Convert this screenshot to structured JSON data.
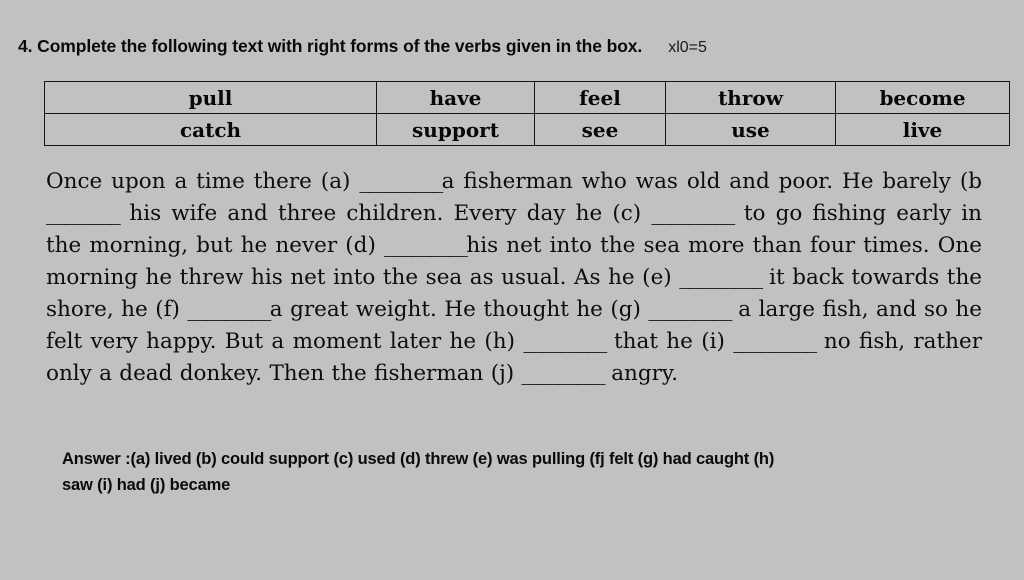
{
  "page": {
    "background_color": "#c1c1c1",
    "text_color": "#0d0d0d"
  },
  "heading": {
    "question_text": "4. Complete the following text with right forms of the verbs given in the box.",
    "marks": "xl0=5"
  },
  "word_box": {
    "rows": [
      [
        "pull",
        "have",
        "feel",
        "throw",
        "become"
      ],
      [
        "catch",
        "support",
        "see",
        "use",
        "live"
      ]
    ]
  },
  "passage": {
    "line1": "Once upon a time there (a) ",
    "blank_a": "_________",
    "line1b": "a fisherman who was old and poor. He barely (b ",
    "blank_b": "________",
    "line2b": " his wife and three children. Every day he (c) ",
    "blank_c": "_________",
    "line3b": " to go fishing early in the morning, but he never (d) ",
    "blank_d": "_________",
    "line4b": "his net into the sea more than four times. One morning he threw his net into the sea as usual. As he (e) ",
    "blank_e": "_________",
    "line5b": " it back towards the shore, he (f) ",
    "blank_f": "_________",
    "line6b": "a great weight. He thought he (g) ",
    "blank_g": "_________",
    "line7b": " a large fish, and so he felt very happy. But a moment later he (h) ",
    "blank_h": "_________",
    "line8b": " that he (i) ",
    "blank_i": "_________",
    "line9b": " no fish, rather only a dead donkey. Then the fisherman (j) ",
    "blank_j": "_________",
    "line10b": " angry."
  },
  "answer_key": {
    "line1": "Answer :(a) lived (b) could support (c) used (d) threw (e) was pulling (fj felt (g) had caught (h)",
    "line2": "saw (i) had (j) became"
  }
}
